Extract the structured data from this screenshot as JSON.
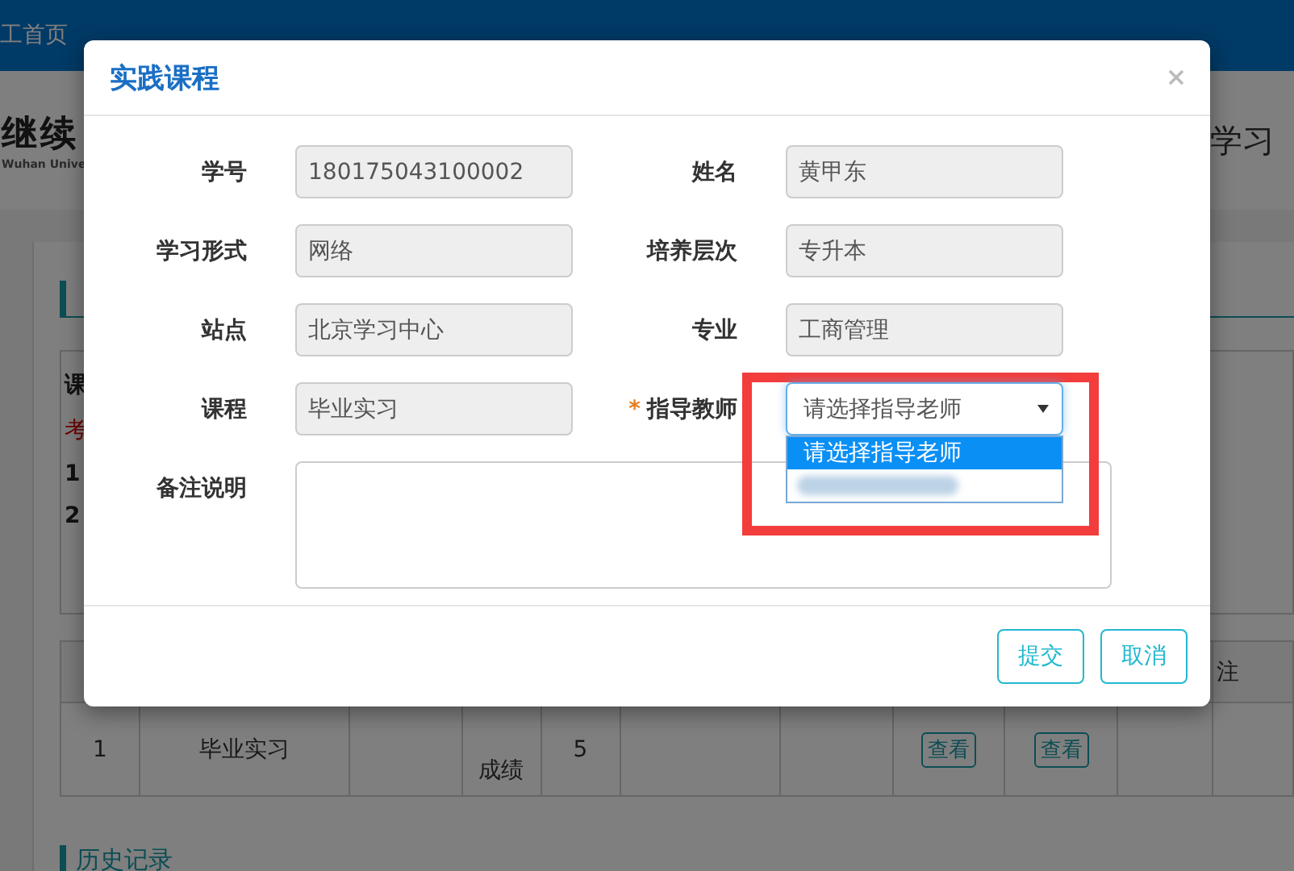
{
  "background": {
    "nav": {
      "link": "工首页"
    },
    "header": {
      "title": "继续",
      "subtitle": "Wuhan Unive",
      "right_text": "学习"
    },
    "info_box": {
      "lines": [
        {
          "text": "课",
          "kind": "bold"
        },
        {
          "text": "考",
          "kind": "warning"
        },
        {
          "text": "1",
          "kind": "bold"
        },
        {
          "text": "2",
          "kind": "bold"
        }
      ]
    },
    "table": {
      "column_10": "注",
      "rows": [
        {
          "index": "1",
          "course": "毕业实习",
          "status": "成绩",
          "credit": "5",
          "actions": [
            "查看",
            "查看"
          ]
        }
      ]
    },
    "history": {
      "title": "历史记录"
    }
  },
  "dialog": {
    "title": "实践课程",
    "fields": [
      {
        "label": "学号",
        "value": "180175043100002",
        "kind": "readonly"
      },
      {
        "label": "姓名",
        "value": "黄甲东",
        "kind": "readonly"
      },
      {
        "label": "学习形式",
        "value": "网络",
        "kind": "readonly"
      },
      {
        "label": "培养层次",
        "value": "专升本",
        "kind": "readonly"
      },
      {
        "label": "站点",
        "value": "北京学习中心",
        "kind": "readonly"
      },
      {
        "label": "专业",
        "value": "工商管理",
        "kind": "readonly"
      },
      {
        "label": "课程",
        "value": "毕业实习",
        "kind": "readonly"
      },
      {
        "label": "指导教师",
        "required_mark": "*",
        "value": "请选择指导老师",
        "kind": "select",
        "expanded": true,
        "options": [
          {
            "label": "请选择指导老师",
            "selected": true
          },
          {
            "kind": "blurred",
            "selected": false
          }
        ]
      }
    ],
    "remark": {
      "label": "备注说明"
    },
    "buttons": [
      "提交",
      "取消"
    ]
  },
  "annotation": {
    "kind": "highlight-box"
  }
}
